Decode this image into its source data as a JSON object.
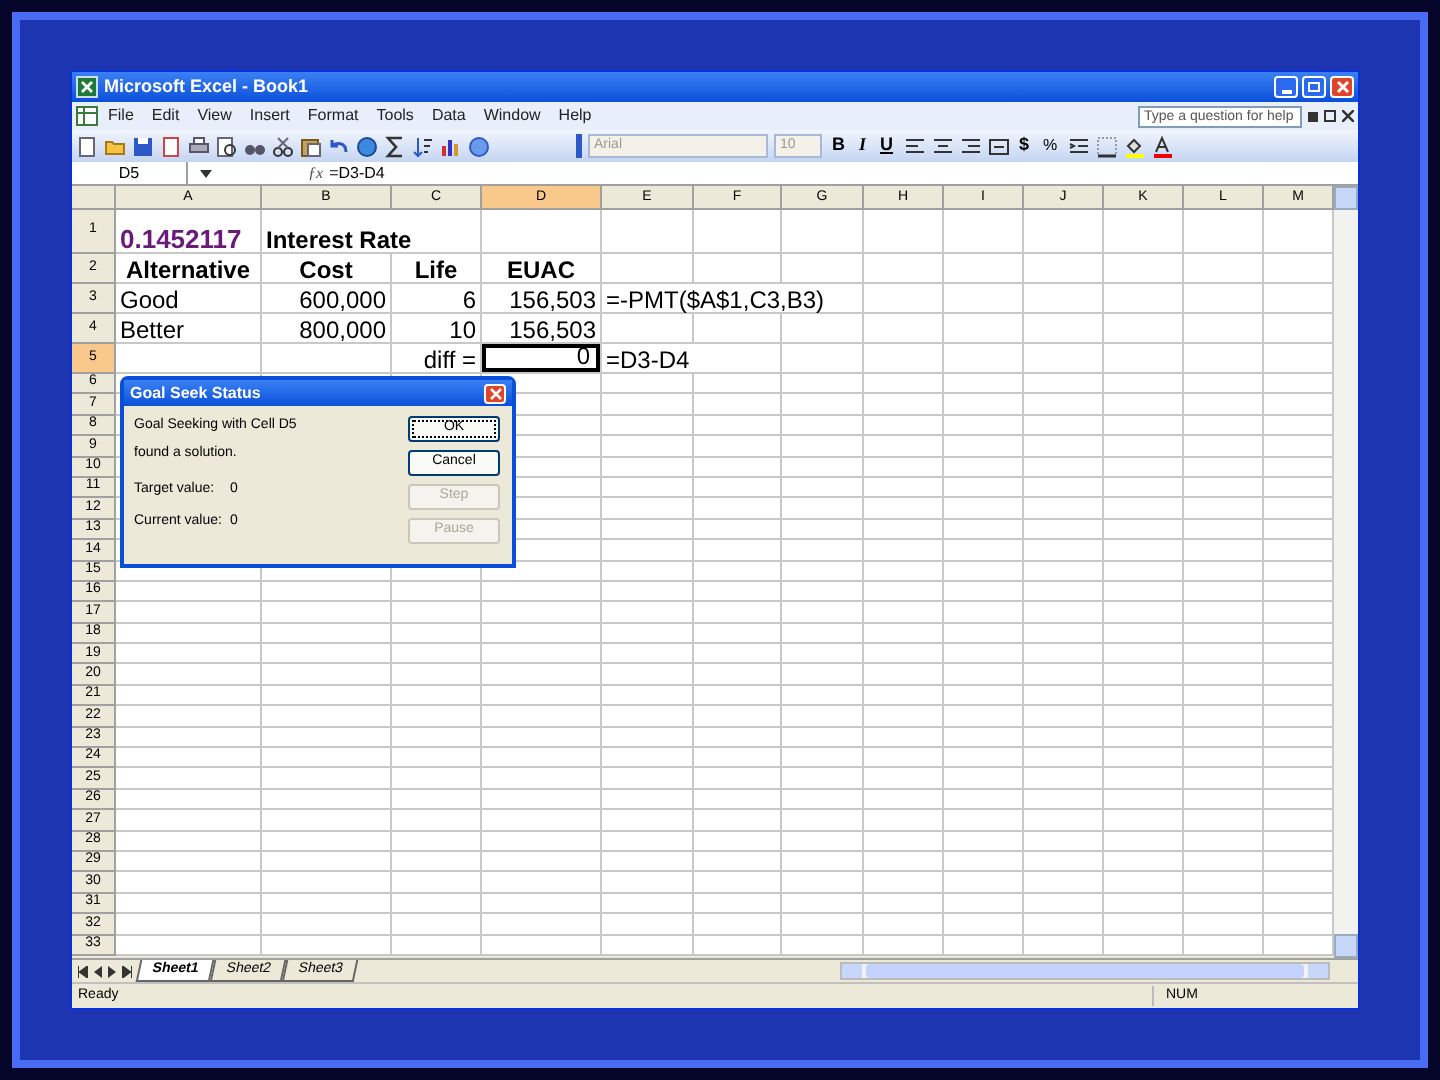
{
  "window": {
    "title": "Microsoft Excel - Book1"
  },
  "menu": [
    "File",
    "Edit",
    "View",
    "Insert",
    "Format",
    "Tools",
    "Data",
    "Window",
    "Help"
  ],
  "help_box": {
    "placeholder": "Type a question for help"
  },
  "toolbar": {
    "font": "Arial",
    "size": "10",
    "bold": "B",
    "italic": "I",
    "underline": "U",
    "currency": "$",
    "percent": "%"
  },
  "formula_bar": {
    "name_box": "D5",
    "fx": "ƒx",
    "formula": "=D3-D4"
  },
  "columns": [
    {
      "label": "A",
      "selected": false
    },
    {
      "label": "B",
      "selected": false
    },
    {
      "label": "C",
      "selected": false
    },
    {
      "label": "D",
      "selected": true
    },
    {
      "label": "E",
      "selected": false
    },
    {
      "label": "F",
      "selected": false
    },
    {
      "label": "G",
      "selected": false
    },
    {
      "label": "H",
      "selected": false
    },
    {
      "label": "I",
      "selected": false
    },
    {
      "label": "J",
      "selected": false
    },
    {
      "label": "K",
      "selected": false
    },
    {
      "label": "L",
      "selected": false
    },
    {
      "label": "M",
      "selected": false
    }
  ],
  "rows": [
    {
      "label": "1",
      "selected": false,
      "kind": "title",
      "cells": {
        "A": "0.1452117",
        "B": "Interest Rate"
      }
    },
    {
      "label": "2",
      "selected": false,
      "kind": "header",
      "cells": {
        "A": "Alternative",
        "B": "Cost",
        "C": "Life",
        "D": "EUAC"
      }
    },
    {
      "label": "3",
      "selected": false,
      "kind": "data",
      "cells": {
        "A": "Good",
        "B": "600,000",
        "C": "6",
        "D": "156,503",
        "E": "=-PMT($A$1,C3,B3)"
      }
    },
    {
      "label": "4",
      "selected": false,
      "kind": "data",
      "cells": {
        "A": "Better",
        "B": "800,000",
        "C": "10",
        "D": "156,503"
      }
    },
    {
      "label": "5",
      "selected": true,
      "kind": "data",
      "cells": {
        "C": "diff =",
        "D": "0",
        "E": "=D3-D4"
      }
    },
    {
      "label": "6",
      "selected": false,
      "kind": "empty"
    },
    {
      "label": "7",
      "selected": false,
      "kind": "empty"
    },
    {
      "label": "8",
      "selected": false,
      "kind": "empty"
    },
    {
      "label": "9",
      "selected": false,
      "kind": "empty"
    },
    {
      "label": "10",
      "selected": false,
      "kind": "empty"
    },
    {
      "label": "11",
      "selected": false,
      "kind": "empty"
    },
    {
      "label": "12",
      "selected": false,
      "kind": "empty"
    },
    {
      "label": "13",
      "selected": false,
      "kind": "empty"
    },
    {
      "label": "14",
      "selected": false,
      "kind": "empty"
    },
    {
      "label": "15",
      "selected": false,
      "kind": "empty"
    },
    {
      "label": "16",
      "selected": false,
      "kind": "empty"
    },
    {
      "label": "17",
      "selected": false,
      "kind": "empty"
    },
    {
      "label": "18",
      "selected": false,
      "kind": "empty"
    },
    {
      "label": "19",
      "selected": false,
      "kind": "empty"
    },
    {
      "label": "20",
      "selected": false,
      "kind": "empty"
    },
    {
      "label": "21",
      "selected": false,
      "kind": "empty"
    },
    {
      "label": "22",
      "selected": false,
      "kind": "empty"
    },
    {
      "label": "23",
      "selected": false,
      "kind": "empty"
    },
    {
      "label": "24",
      "selected": false,
      "kind": "empty"
    },
    {
      "label": "25",
      "selected": false,
      "kind": "empty"
    },
    {
      "label": "26",
      "selected": false,
      "kind": "empty"
    },
    {
      "label": "27",
      "selected": false,
      "kind": "empty"
    },
    {
      "label": "28",
      "selected": false,
      "kind": "empty"
    },
    {
      "label": "29",
      "selected": false,
      "kind": "empty"
    },
    {
      "label": "30",
      "selected": false,
      "kind": "empty"
    },
    {
      "label": "31",
      "selected": false,
      "kind": "empty"
    },
    {
      "label": "32",
      "selected": false,
      "kind": "empty"
    },
    {
      "label": "33",
      "selected": false,
      "kind": "empty"
    }
  ],
  "sheet_tabs": [
    {
      "label": "Sheet1",
      "selected": true
    },
    {
      "label": "Sheet2",
      "selected": false
    },
    {
      "label": "Sheet3",
      "selected": false
    }
  ],
  "status_bar": {
    "text": "Ready",
    "indicator": "NUM"
  },
  "dialog": {
    "title": "Goal Seek Status",
    "message": [
      "Goal Seeking with Cell D5",
      "found a solution."
    ],
    "values": [
      {
        "label": "Target value:",
        "value": "0"
      },
      {
        "label": "Current value:",
        "value": "0"
      }
    ],
    "buttons": [
      {
        "label": "OK",
        "disabled": false,
        "default": true
      },
      {
        "label": "Cancel",
        "disabled": false,
        "default": false
      },
      {
        "label": "Step",
        "disabled": true,
        "default": false
      },
      {
        "label": "Pause",
        "disabled": true,
        "default": false
      }
    ]
  }
}
